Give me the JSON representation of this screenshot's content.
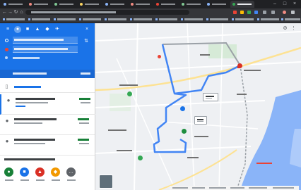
{
  "colors": {
    "tabbar": "#202124",
    "toolbar": "#35363a",
    "panel_header": "#1a73e8",
    "route_blue": "#4285f4",
    "route_gray": "#9aa0a6",
    "water": "#8ab4f8",
    "destination_pin": "#d93025"
  },
  "browser": {
    "tabs": [
      {
        "icon": "favicon-icon",
        "color": "#8ab4f8"
      },
      {
        "icon": "favicon-icon",
        "color": "#f28b82"
      },
      {
        "icon": "favicon-icon",
        "color": "#81c995"
      },
      {
        "icon": "favicon-icon",
        "color": "#fdd663"
      },
      {
        "icon": "favicon-icon",
        "color": "#8ab4f8"
      },
      {
        "icon": "favicon-icon",
        "color": "#f28b82"
      },
      {
        "icon": "favicon-icon",
        "color": "#ea4335"
      },
      {
        "icon": "favicon-icon",
        "color": "#81c995"
      },
      {
        "icon": "favicon-icon",
        "color": "#8ab4f8"
      },
      {
        "icon": "maps-favicon-icon",
        "color": "#34a853",
        "active": true
      }
    ],
    "toolbar_icons": [
      "back-arrow-icon",
      "forward-arrow-icon",
      "reload-icon",
      "home-icon"
    ],
    "window_controls": [
      "minimize-icon",
      "maximize-icon",
      "close-icon"
    ]
  },
  "directions": {
    "travel_modes": [
      "best-route-icon",
      "car-icon",
      "transit-icon",
      "walk-icon",
      "bike-icon",
      "flight-icon"
    ],
    "selected_mode": 1,
    "routes_count": 3,
    "nearby_categories": [
      {
        "icon": "restaurant-icon",
        "color": "#188038"
      },
      {
        "icon": "hotel-icon",
        "color": "#1a73e8"
      },
      {
        "icon": "gas-station-icon",
        "color": "#d93025"
      },
      {
        "icon": "shopping-icon",
        "color": "#f29900"
      },
      {
        "icon": "more-icon",
        "color": "#5f6368"
      }
    ]
  },
  "map": {
    "controls": [
      "share-icon",
      "settings-icon"
    ],
    "layers_icon": "layers-icon"
  }
}
